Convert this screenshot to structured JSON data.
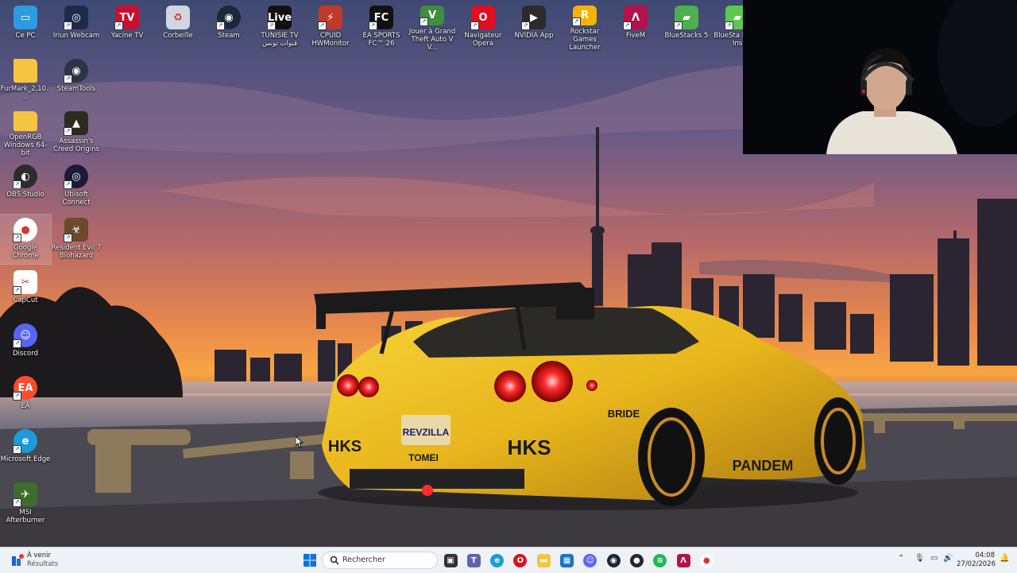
{
  "desktop": {
    "icons": [
      {
        "label": "Ce PC",
        "icon": "monitor-icon",
        "color": "#2d9be0"
      },
      {
        "label": "Iriun Webcam",
        "icon": "webcam-icon",
        "color": "#1d2b4a"
      },
      {
        "label": "Yacine TV",
        "icon": "tv-icon",
        "color": "#c8102e"
      },
      {
        "label": "Corbeille",
        "icon": "recycle-bin-icon",
        "color": "#cfd8e0"
      },
      {
        "label": "Steam",
        "icon": "steam-icon",
        "color": "#1b2838"
      },
      {
        "label": "TUNISIE TV قنوات تونس",
        "icon": "live-tv-icon",
        "color": "#111111"
      },
      {
        "label": "CPUID HWMonitor",
        "icon": "hwmonitor-icon",
        "color": "#c0392b"
      },
      {
        "label": "EA SPORTS FC™ 26",
        "icon": "fc26-icon",
        "color": "#111111"
      },
      {
        "label": "Jouer à Grand Theft Auto V V...",
        "icon": "gta-icon",
        "color": "#3f8d3f"
      },
      {
        "label": "Navigateur Opera",
        "icon": "opera-icon",
        "color": "#e0101f"
      },
      {
        "label": "NVIDIA App",
        "icon": "nvidia-icon",
        "color": "#2b2b2b"
      },
      {
        "label": "Rockstar Games Launcher",
        "icon": "rockstar-icon",
        "color": "#f5b300"
      },
      {
        "label": "FiveM",
        "icon": "fivem-icon",
        "color": "#b3124a"
      },
      {
        "label": "BlueStacks 5",
        "icon": "bluestacks-icon",
        "color": "#4caf50"
      },
      {
        "label": "BlueSta Multi-Ins",
        "icon": "bluestacks-multi-icon",
        "color": "#5cc84f"
      },
      {
        "label": "FurMark_2.10....",
        "icon": "folder-icon",
        "color": "#f5c542"
      },
      {
        "label": "SteamTools",
        "icon": "steamtools-icon",
        "color": "#2a3442"
      },
      {
        "label": "OpenRGB Windows 64-bit",
        "icon": "folder-icon",
        "color": "#f5c542"
      },
      {
        "label": "Assassin's Creed Origins",
        "icon": "ac-origins-icon",
        "color": "#2d2a20"
      },
      {
        "label": "OBS Studio",
        "icon": "obs-icon",
        "color": "#2c2c2c"
      },
      {
        "label": "Ubisoft Connect",
        "icon": "ubisoft-icon",
        "color": "#1a1a3a"
      },
      {
        "label": "Google Chrome",
        "icon": "chrome-icon",
        "color": "#ffffff"
      },
      {
        "label": "Resident Evil 7 Biohazard",
        "icon": "re7-icon",
        "color": "#6b4a2b"
      },
      {
        "label": "CapCut",
        "icon": "capcut-icon",
        "color": "#ffffff"
      },
      {
        "label": "Discord",
        "icon": "discord-icon",
        "color": "#5865f2"
      },
      {
        "label": "EA",
        "icon": "ea-icon",
        "color": "#ff4b2b"
      },
      {
        "label": "Microsoft Edge",
        "icon": "edge-icon",
        "color": "#1b9bd7"
      },
      {
        "label": "MSI Afterburner",
        "icon": "afterburner-icon",
        "color": "#3d6e2e"
      }
    ]
  },
  "wallpaper": {
    "plate": "REVZILLA",
    "brand_left": "HKS",
    "brand_right": "HKS",
    "bumper": "TOMEI",
    "side_decal": "BRIDE",
    "skirt_decal": "PANDEM"
  },
  "taskbar": {
    "weather_title": "À venir",
    "weather_subtitle": "Résultats",
    "search_placeholder": "Rechercher",
    "time": "04:08",
    "date": "27/02/2026",
    "apps": [
      {
        "icon": "task-view-icon",
        "color": "#333333"
      },
      {
        "icon": "teams-icon",
        "color": "#6264a7"
      },
      {
        "icon": "edge-icon",
        "color": "#1b9bd7"
      },
      {
        "icon": "opera-icon",
        "color": "#e0101f"
      },
      {
        "icon": "file-explorer-icon",
        "color": "#f5c542"
      },
      {
        "icon": "store-icon",
        "color": "#1a73c9"
      },
      {
        "icon": "discord-icon",
        "color": "#5865f2"
      },
      {
        "icon": "steam-icon",
        "color": "#1b2838"
      },
      {
        "icon": "github-icon",
        "color": "#24292e"
      },
      {
        "icon": "spotify-icon",
        "color": "#1db954"
      },
      {
        "icon": "fivem-icon",
        "color": "#b3124a"
      },
      {
        "icon": "chrome-icon",
        "color": "#ffffff"
      }
    ]
  }
}
